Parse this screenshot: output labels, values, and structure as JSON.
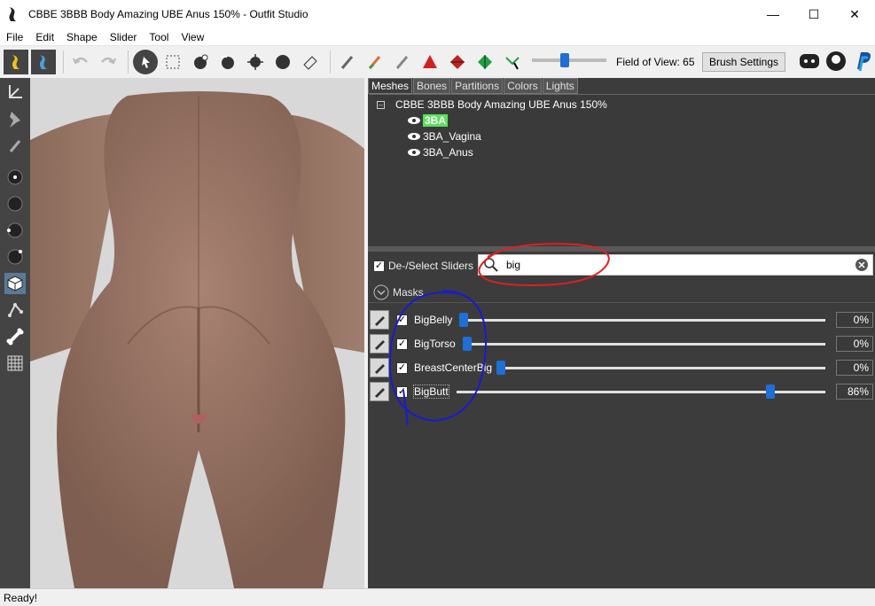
{
  "window": {
    "title": "CBBE 3BBB Body Amazing UBE Anus 150% - Outfit Studio"
  },
  "menu": [
    "File",
    "Edit",
    "Shape",
    "Slider",
    "Tool",
    "View"
  ],
  "toolbar": {
    "fov_label": "Field of View: 65",
    "fov_value": 65,
    "brush_settings": "Brush Settings"
  },
  "tabs": [
    "Meshes",
    "Bones",
    "Partitions",
    "Colors",
    "Lights"
  ],
  "tree": {
    "root": "CBBE 3BBB Body Amazing UBE Anus 150%",
    "meshes": [
      "3BA",
      "3BA_Vagina",
      "3BA_Anus"
    ]
  },
  "filter": {
    "deselect_label": "De-/Select Sliders",
    "search_value": "big"
  },
  "masks_label": "Masks",
  "sliders": [
    {
      "name": "BigBelly",
      "value": "0%",
      "level": 0
    },
    {
      "name": "BigTorso",
      "value": "0%",
      "level": 0
    },
    {
      "name": "BreastCenterBig",
      "value": "0%",
      "level": 0
    },
    {
      "name": "BigButt",
      "value": "86%",
      "level": 86
    }
  ],
  "status": "Ready!",
  "colors": {
    "accent": "#1f6fd6",
    "highlight": "#5be05b",
    "panel": "#3c3c3c",
    "annotation_red": "#e02020",
    "annotation_blue": "#1a1ad0"
  }
}
